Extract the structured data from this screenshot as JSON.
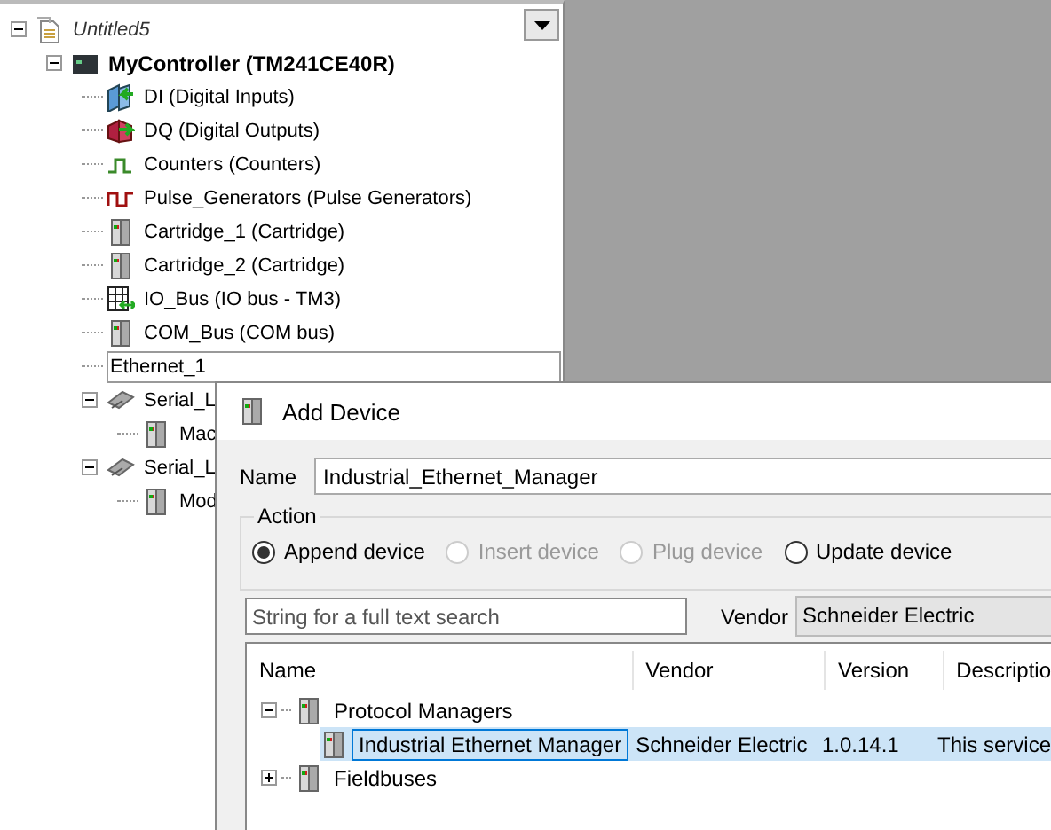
{
  "device_tree": {
    "items": [
      {
        "label": "Untitled5",
        "kind": "document",
        "expanded": true,
        "editing": false,
        "children": [
          {
            "label": "MyController (TM241CE40R)",
            "kind": "controller",
            "expanded": true,
            "editing": false,
            "children": [
              {
                "label": "DI (Digital Inputs)",
                "kind": "di",
                "editing": false
              },
              {
                "label": "DQ (Digital Outputs)",
                "kind": "dq",
                "editing": false
              },
              {
                "label": "Counters (Counters)",
                "kind": "counter",
                "editing": false
              },
              {
                "label": "Pulse_Generators (Pulse Generators)",
                "kind": "pulse",
                "editing": false
              },
              {
                "label": "Cartridge_1 (Cartridge)",
                "kind": "module",
                "editing": false
              },
              {
                "label": "Cartridge_2 (Cartridge)",
                "kind": "module",
                "editing": false
              },
              {
                "label": "IO_Bus (IO bus - TM3)",
                "kind": "iobus",
                "editing": false
              },
              {
                "label": "COM_Bus (COM bus)",
                "kind": "module",
                "editing": false
              },
              {
                "label": "Ethernet_1",
                "editing": true
              },
              {
                "label": "Serial_L",
                "kind": "serial",
                "expanded": true,
                "editing": false,
                "children": [
                  {
                    "label": "Mac",
                    "kind": "module",
                    "editing": false
                  }
                ]
              },
              {
                "label": "Serial_L",
                "kind": "serial",
                "expanded": true,
                "editing": false,
                "children": [
                  {
                    "label": "Mod",
                    "kind": "module",
                    "editing": false
                  }
                ]
              }
            ]
          }
        ]
      }
    ]
  },
  "dialog": {
    "title": "Add Device",
    "name_label": "Name",
    "name_value": "Industrial_Ethernet_Manager",
    "action": {
      "label": "Action",
      "options": [
        {
          "label": "Append device",
          "selected": true,
          "disabled": false
        },
        {
          "label": "Insert device",
          "selected": false,
          "disabled": true
        },
        {
          "label": "Plug device",
          "selected": false,
          "disabled": true
        },
        {
          "label": "Update device",
          "selected": false,
          "disabled": false
        }
      ]
    },
    "search": {
      "placeholder": "String for a full text search"
    },
    "vendor_label": "Vendor",
    "vendor_value": "Schneider Electric",
    "columns": [
      "Name",
      "Vendor",
      "Version",
      "Descriptio"
    ],
    "groups": [
      {
        "label": "Protocol Managers",
        "expanded": true,
        "children": [
          {
            "name": "Industrial Ethernet Manager",
            "vendor": "Schneider Electric",
            "version": "1.0.14.1",
            "description": "This service",
            "selected": true
          }
        ]
      },
      {
        "label": "Fieldbuses",
        "expanded": false
      }
    ]
  }
}
